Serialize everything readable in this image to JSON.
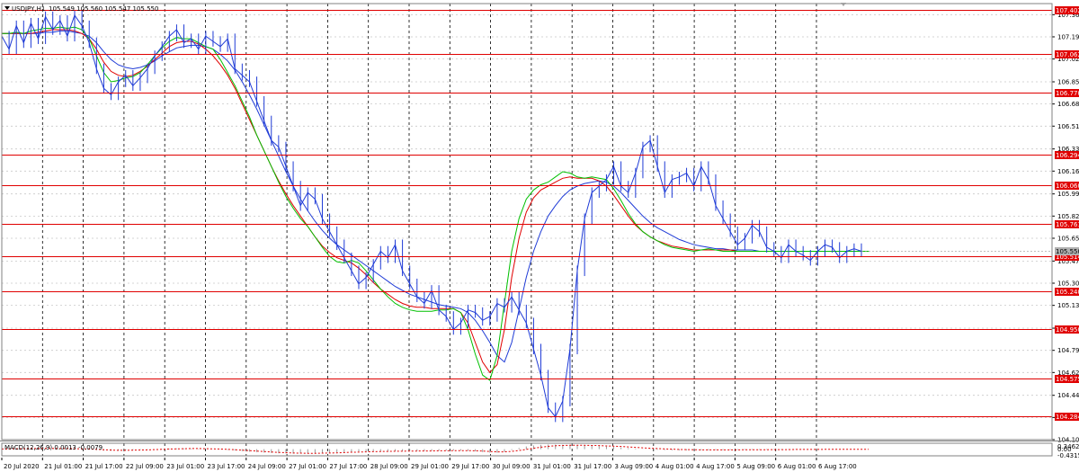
{
  "header": {
    "symbol_label": "USDJPY,H1",
    "ohlc_label": "105.549 105.560 105.547 105.550"
  },
  "macd_header": {
    "label": "MACD(12,26,9) 0.0013 -0.0079"
  },
  "colors": {
    "price": "#1f3bd6",
    "ma_fast": "#00c000",
    "ma_mid": "#e00000",
    "ma_slow": "#1f3bd6",
    "level_line": "#e00000",
    "grid": "#000000"
  },
  "chart_data": [
    {
      "type": "line",
      "title": "USDJPY,H1",
      "ylim": [
        104.105,
        107.45
      ],
      "y_ticks": [
        "107.365",
        "107.195",
        "107.025",
        "106.850",
        "106.680",
        "106.510",
        "106.335",
        "106.165",
        "105.990",
        "105.820",
        "105.650",
        "105.475",
        "105.305",
        "105.135",
        "104.960",
        "104.790",
        "104.620",
        "104.445",
        "104.275",
        "104.105"
      ],
      "x_ticks": [
        "20 Jul 2020",
        "21 Jul 01:00",
        "21 Jul 17:00",
        "22 Jul 09:00",
        "23 Jul 01:00",
        "23 Jul 17:00",
        "24 Jul 09:00",
        "27 Jul 01:00",
        "27 Jul 17:00",
        "28 Jul 09:00",
        "29 Jul 01:00",
        "29 Jul 17:00",
        "30 Jul 09:00",
        "31 Jul 01:00",
        "31 Jul 17:00",
        "3 Aug 09:00",
        "4 Aug 01:00",
        "4 Aug 17:00",
        "5 Aug 09:00",
        "6 Aug 01:00",
        "6 Aug 17:00"
      ],
      "horizontal_levels": [
        "107.402",
        "107.062",
        "106.770",
        "106.294",
        "106.060",
        "105.761",
        "105.514",
        "105.240",
        "104.950",
        "104.575",
        "104.284"
      ],
      "current_price_label": "105.550",
      "grid": true,
      "series": [
        {
          "values": [
            107.2,
            107.1,
            107.28,
            107.15,
            107.3,
            107.18,
            107.35,
            107.25,
            107.32,
            107.2,
            107.36,
            107.28,
            107.15,
            106.95,
            106.8,
            106.75,
            106.85,
            106.9,
            106.82,
            106.88,
            106.95,
            107.05,
            107.12,
            107.2,
            107.25,
            107.15,
            107.18,
            107.1,
            107.2,
            107.16,
            107.12,
            107.18,
            106.95,
            106.9,
            106.85,
            106.7,
            106.55,
            106.4,
            106.35,
            106.2,
            106.05,
            105.9,
            106.0,
            105.95,
            105.8,
            105.7,
            105.6,
            105.5,
            105.4,
            105.3,
            105.35,
            105.45,
            105.55,
            105.5,
            105.6,
            105.4,
            105.3,
            105.2,
            105.15,
            105.25,
            105.1,
            105.05,
            104.95,
            105.0,
            105.1,
            105.08,
            105.02,
            105.05,
            105.15,
            105.12,
            105.2,
            105.1,
            105.0,
            104.8,
            104.6,
            104.35,
            104.28,
            104.4,
            104.8,
            105.4,
            105.8,
            106.0,
            106.05,
            106.1,
            106.2,
            106.05,
            106.0,
            106.15,
            106.35,
            106.4,
            106.2,
            106.0,
            106.1,
            106.12,
            106.15,
            106.05,
            106.2,
            106.1,
            105.9,
            105.8,
            105.7,
            105.6,
            105.65,
            105.75,
            105.7,
            105.58,
            105.55,
            105.5,
            105.6,
            105.55,
            105.52,
            105.48,
            105.55,
            105.6,
            105.58,
            105.5,
            105.55,
            105.57,
            105.55
          ]
        },
        {
          "name": "",
          "values": [
            107.22,
            107.22,
            107.23,
            107.22,
            107.24,
            107.25,
            107.26,
            107.26,
            107.27,
            107.26,
            107.27,
            107.25,
            107.18,
            107.05,
            106.92,
            106.85,
            106.86,
            106.88,
            106.89,
            106.92,
            106.98,
            107.05,
            107.11,
            107.16,
            107.19,
            107.18,
            107.18,
            107.15,
            107.12,
            107.1,
            107.02,
            106.92,
            106.82,
            106.7,
            106.58,
            106.44,
            106.32,
            106.2,
            106.08,
            105.97,
            105.88,
            105.8,
            105.74,
            105.66,
            105.58,
            105.51,
            105.47,
            105.46,
            105.48,
            105.46,
            105.4,
            105.33,
            105.26,
            105.2,
            105.15,
            105.12,
            105.1,
            105.09,
            105.09,
            105.09,
            105.1,
            105.1,
            105.11,
            105.08,
            104.95,
            104.76,
            104.6,
            104.56,
            104.75,
            105.15,
            105.55,
            105.8,
            105.95,
            106.02,
            106.06,
            106.08,
            106.12,
            106.16,
            106.15,
            106.12,
            106.11,
            106.12,
            106.11,
            106.1,
            106.03,
            105.94,
            105.84,
            105.76,
            105.7,
            105.66,
            105.63,
            105.6,
            105.58,
            105.57,
            105.56,
            105.55,
            105.56,
            105.57,
            105.56,
            105.55,
            105.55,
            105.55,
            105.55,
            105.55,
            105.55,
            105.55,
            105.55,
            105.55,
            105.55,
            105.55,
            105.55,
            105.55,
            105.55,
            105.55,
            105.55,
            105.55,
            105.55,
            105.55,
            105.55,
            105.55
          ]
        },
        {
          "name": "",
          "values": [
            107.22,
            107.22,
            107.22,
            107.22,
            107.22,
            107.23,
            107.24,
            107.25,
            107.25,
            107.25,
            107.24,
            107.22,
            107.18,
            107.1,
            107.0,
            106.93,
            106.9,
            106.89,
            106.9,
            106.93,
            106.97,
            107.02,
            107.07,
            107.12,
            107.15,
            107.16,
            107.16,
            107.14,
            107.1,
            107.05,
            106.98,
            106.9,
            106.8,
            106.68,
            106.56,
            106.44,
            106.32,
            106.2,
            106.09,
            105.99,
            105.9,
            105.82,
            105.74,
            105.66,
            105.59,
            105.54,
            105.5,
            105.48,
            105.46,
            105.42,
            105.37,
            105.31,
            105.26,
            105.22,
            105.18,
            105.15,
            105.13,
            105.12,
            105.12,
            105.11,
            105.11,
            105.11,
            105.11,
            105.08,
            105.0,
            104.85,
            104.7,
            104.62,
            104.68,
            104.95,
            105.35,
            105.65,
            105.85,
            105.96,
            106.02,
            106.05,
            106.08,
            106.11,
            106.12,
            106.11,
            106.11,
            106.11,
            106.09,
            106.05,
            105.98,
            105.9,
            105.82,
            105.75,
            105.7,
            105.66,
            105.63,
            105.61,
            105.59,
            105.58,
            105.57,
            105.56,
            105.56,
            105.56,
            105.56,
            105.56,
            105.56,
            105.55,
            105.55,
            105.55,
            105.55,
            105.55,
            105.55,
            105.55,
            105.55,
            105.55,
            105.55,
            105.55,
            105.55,
            105.55,
            105.55,
            105.55,
            105.55,
            105.55,
            105.55,
            105.55
          ]
        },
        {
          "name": "",
          "values": [
            107.22,
            107.22,
            107.22,
            107.22,
            107.22,
            107.22,
            107.23,
            107.23,
            107.24,
            107.24,
            107.23,
            107.22,
            107.2,
            107.15,
            107.08,
            107.02,
            106.98,
            106.96,
            106.95,
            106.96,
            106.98,
            107.01,
            107.05,
            107.08,
            107.11,
            107.12,
            107.13,
            107.13,
            107.12,
            107.1,
            107.06,
            107.01,
            106.94,
            106.85,
            106.75,
            106.64,
            106.52,
            106.4,
            106.28,
            106.16,
            106.05,
            105.95,
            105.86,
            105.78,
            105.71,
            105.65,
            105.6,
            105.56,
            105.52,
            105.48,
            105.44,
            105.4,
            105.36,
            105.32,
            105.28,
            105.25,
            105.22,
            105.2,
            105.18,
            105.16,
            105.14,
            105.13,
            105.12,
            105.11,
            105.08,
            105.02,
            104.94,
            104.85,
            104.75,
            104.7,
            104.85,
            105.1,
            105.35,
            105.55,
            105.7,
            105.82,
            105.9,
            105.97,
            106.02,
            106.05,
            106.07,
            106.08,
            106.09,
            106.08,
            106.05,
            106.0,
            105.94,
            105.88,
            105.82,
            105.77,
            105.73,
            105.7,
            105.67,
            105.64,
            105.62,
            105.6,
            105.59,
            105.58,
            105.57,
            105.57,
            105.56,
            105.56,
            105.56,
            105.56,
            105.55,
            105.55,
            105.55,
            105.55,
            105.55,
            105.55,
            105.55,
            105.55,
            105.55,
            105.55,
            105.55,
            105.55,
            105.55,
            105.55,
            105.55,
            105.55
          ]
        }
      ]
    },
    {
      "type": "bar",
      "title": "MACD(12,26,9)",
      "ylim": [
        -0.45,
        0.4
      ],
      "y_ticks": [
        "0.3462",
        "0.00",
        "-0.4315"
      ],
      "series": [
        {
          "values": [
            0.02,
            0.03,
            0.04,
            0.04,
            0.05,
            0.05,
            0.05,
            0.04,
            0.04,
            0.03,
            0.03,
            0.01,
            -0.03,
            -0.07,
            -0.1,
            -0.11,
            -0.1,
            -0.08,
            -0.06,
            -0.04,
            -0.02,
            0.0,
            0.02,
            0.04,
            0.05,
            0.05,
            0.04,
            0.03,
            0.01,
            0.0,
            -0.02,
            -0.05,
            -0.09,
            -0.13,
            -0.17,
            -0.2,
            -0.23,
            -0.26,
            -0.28,
            -0.29,
            -0.3,
            -0.3,
            -0.29,
            -0.28,
            -0.26,
            -0.24,
            -0.22,
            -0.2,
            -0.18,
            -0.16,
            -0.15,
            -0.14,
            -0.14,
            -0.13,
            -0.13,
            -0.12,
            -0.12,
            -0.12,
            -0.11,
            -0.1,
            -0.1,
            -0.09,
            -0.09,
            -0.09,
            -0.11,
            -0.15,
            -0.2,
            -0.24,
            -0.24,
            -0.18,
            -0.06,
            0.08,
            0.18,
            0.25,
            0.29,
            0.31,
            0.31,
            0.3,
            0.29,
            0.27,
            0.25,
            0.23,
            0.21,
            0.18,
            0.15,
            0.11,
            0.07,
            0.04,
            0.01,
            -0.02,
            -0.04,
            -0.06,
            -0.07,
            -0.08,
            -0.08,
            -0.08,
            -0.07,
            -0.07,
            -0.06,
            -0.06,
            -0.05,
            -0.05,
            -0.04,
            -0.04,
            -0.04,
            -0.03,
            -0.03,
            -0.03,
            -0.02,
            -0.02,
            -0.02,
            -0.01,
            -0.01,
            -0.01,
            0.0,
            0.0,
            0.0,
            0.0,
            0.0,
            0.0
          ]
        },
        {
          "values": [
            0.01,
            0.02,
            0.03,
            0.03,
            0.04,
            0.04,
            0.05,
            0.05,
            0.04,
            0.04,
            0.03,
            0.02,
            0.01,
            -0.01,
            -0.04,
            -0.06,
            -0.08,
            -0.08,
            -0.07,
            -0.06,
            -0.05,
            -0.03,
            -0.01,
            0.01,
            0.02,
            0.03,
            0.04,
            0.04,
            0.03,
            0.02,
            0.01,
            -0.01,
            -0.04,
            -0.07,
            -0.1,
            -0.13,
            -0.16,
            -0.19,
            -0.22,
            -0.24,
            -0.26,
            -0.27,
            -0.28,
            -0.28,
            -0.27,
            -0.26,
            -0.25,
            -0.23,
            -0.21,
            -0.2,
            -0.18,
            -0.17,
            -0.16,
            -0.15,
            -0.14,
            -0.14,
            -0.13,
            -0.13,
            -0.12,
            -0.12,
            -0.11,
            -0.11,
            -0.1,
            -0.1,
            -0.1,
            -0.11,
            -0.13,
            -0.16,
            -0.18,
            -0.18,
            -0.15,
            -0.09,
            -0.02,
            0.06,
            0.13,
            0.19,
            0.23,
            0.25,
            0.26,
            0.26,
            0.26,
            0.25,
            0.24,
            0.22,
            0.2,
            0.18,
            0.15,
            0.12,
            0.09,
            0.06,
            0.04,
            0.02,
            0.0,
            -0.02,
            -0.03,
            -0.04,
            -0.05,
            -0.05,
            -0.05,
            -0.05,
            -0.05,
            -0.05,
            -0.04,
            -0.04,
            -0.04,
            -0.04,
            -0.03,
            -0.03,
            -0.03,
            -0.02,
            -0.02,
            -0.02,
            -0.02,
            -0.01,
            -0.01,
            -0.01,
            -0.01,
            -0.01,
            -0.01,
            -0.01
          ]
        }
      ]
    }
  ]
}
